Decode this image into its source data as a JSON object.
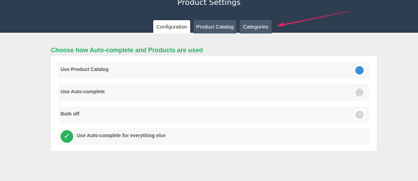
{
  "header": {
    "title": "Product Settings",
    "background_color": "#2d3e50"
  },
  "tabs": [
    {
      "label": "Configuration",
      "active": true
    },
    {
      "label": "Product Catalog",
      "active": false
    },
    {
      "label": "Categories",
      "active": false
    }
  ],
  "annotation": {
    "icon": "arrow-annotation",
    "color": "#e0245e"
  },
  "section": {
    "heading": "Choose how Auto-complete and Products are used",
    "heading_color": "#27ae60"
  },
  "options": [
    {
      "label": "Use Product Catalog",
      "selected": true
    },
    {
      "label": "Use Auto-complete",
      "selected": false
    },
    {
      "label": "Both off",
      "selected": false
    }
  ],
  "fallback": {
    "label": "Use Auto-complete for everything else",
    "checked": true,
    "icon": "check-icon",
    "color": "#2bb15c"
  },
  "colors": {
    "radio_selected": "#3b8fd8",
    "radio_unselected": "#d8d6d2"
  }
}
